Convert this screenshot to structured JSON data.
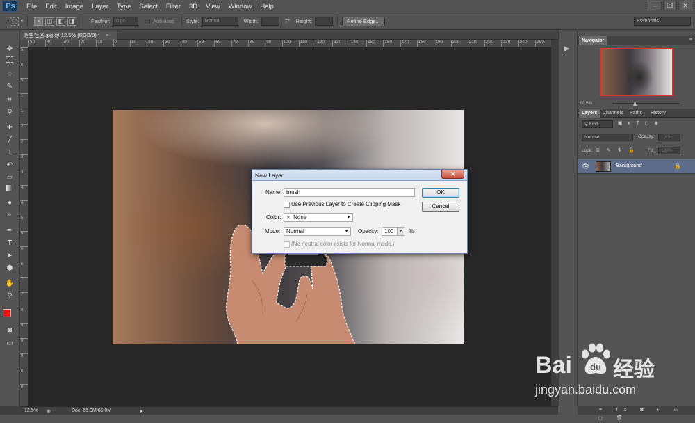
{
  "menu": {
    "logo": "Ps",
    "items": [
      "File",
      "Edit",
      "Image",
      "Layer",
      "Type",
      "Select",
      "Filter",
      "3D",
      "View",
      "Window",
      "Help"
    ]
  },
  "options_bar": {
    "feather_label": "Feather:",
    "feather_value": "0 px",
    "antialias_label": "Anti-alias",
    "style_label": "Style:",
    "style_value": "Normal",
    "width_label": "Width:",
    "height_label": "Height:",
    "refine_edge": "Refine Edge...",
    "workspace": "Essentials"
  },
  "document_tab": {
    "label": "陌鱼社区.jpg @ 12.5% (RGB/8) *",
    "close": "×"
  },
  "ruler": {
    "top": [
      "50",
      "40",
      "30",
      "20",
      "10",
      "0",
      "10",
      "20",
      "30",
      "40",
      "50",
      "60",
      "70",
      "80",
      "90",
      "100",
      "110",
      "120",
      "130",
      "140",
      "150",
      "160",
      "170",
      "180",
      "190",
      "200",
      "210",
      "220",
      "230",
      "240",
      "250"
    ],
    "left": [
      "5",
      "0",
      "5",
      "1",
      "1",
      "2",
      "2",
      "3",
      "3",
      "4",
      "4",
      "5",
      "5",
      "6",
      "6",
      "7",
      "7",
      "8",
      "8",
      "9",
      "9",
      "0",
      "0"
    ]
  },
  "status": {
    "zoom": "12.5%",
    "doc": "Doc: 65.0M/65.0M"
  },
  "navigator": {
    "tab": "Navigator",
    "zoom": "12.5%"
  },
  "layers_panel": {
    "tabs": [
      "Layers",
      "Channels",
      "Paths",
      "History"
    ],
    "kind": "Kind",
    "blend_mode": "Normal",
    "opacity_label": "Opacity:",
    "opacity_value": "100%",
    "lock_label": "Lock:",
    "fill_label": "Fill:",
    "fill_value": "100%",
    "layer_name": "Background"
  },
  "dialog": {
    "title": "New Layer",
    "name_label": "Name:",
    "name_value": "brush",
    "clipping_label": "Use Previous Layer to Create Clipping Mask",
    "color_label": "Color:",
    "color_value": "None",
    "mode_label": "Mode:",
    "mode_value": "Normal",
    "opacity_label": "Opacity:",
    "opacity_value": "100",
    "percent": "%",
    "neutral_label": "(No neutral color exists for Normal mode.)",
    "ok": "OK",
    "cancel": "Cancel"
  },
  "watermark": {
    "brand": "Bai",
    "brand_cn": "经验",
    "url": "jingyan.baidu.com"
  },
  "colors": {
    "foreground": "#e8180f",
    "background": "#000000",
    "selection_border": "#e0302a"
  }
}
